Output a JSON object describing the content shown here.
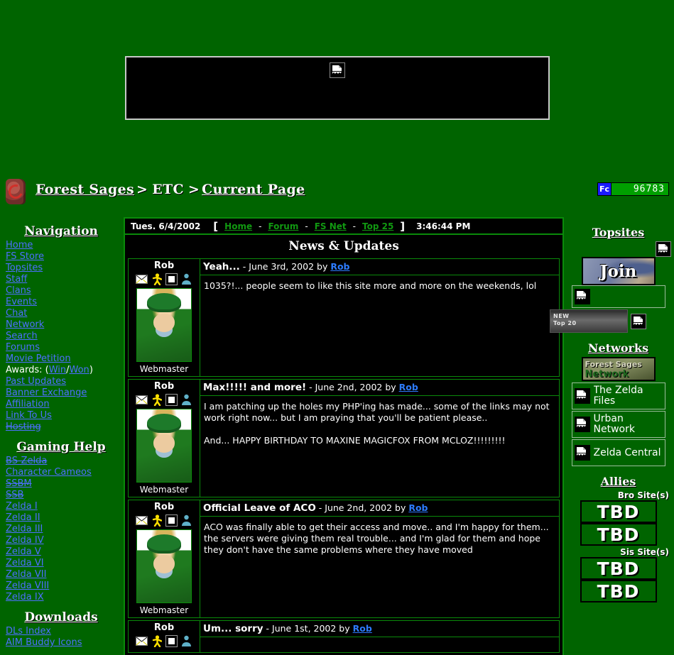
{
  "site": {
    "background_color": "#006400",
    "panel_color": "#000000",
    "border_color": "#0a8a0a",
    "link_color": "#4d6fff"
  },
  "top_banner": {
    "alt": "broken-image",
    "icon": "broken-image-icon"
  },
  "header": {
    "crest_icon": "site-crest-icon",
    "breadcrumb": {
      "home_label": "Forest Sages",
      "sep1": ">",
      "section_label": "ETC",
      "sep2": ">",
      "current_label": "Current Page"
    },
    "counter": {
      "badge": "Fc",
      "value": "96783"
    }
  },
  "sidebar": {
    "navigation_title": "Navigation",
    "navigation_items": [
      {
        "label": "Home",
        "strike": false
      },
      {
        "label": "FS Store",
        "strike": false
      },
      {
        "label": "Topsites",
        "strike": false
      },
      {
        "label": "Staff",
        "strike": false
      },
      {
        "label": "Clans",
        "strike": false
      },
      {
        "label": "Events",
        "strike": false
      },
      {
        "label": "Chat",
        "strike": false
      },
      {
        "label": "Network",
        "strike": false
      },
      {
        "label": "Search",
        "strike": false
      },
      {
        "label": "Forums",
        "strike": false
      },
      {
        "label": "Movie Petition",
        "strike": false
      }
    ],
    "awards": {
      "prefix": "Awards: (",
      "win": "Win",
      "slash": "/",
      "won": "Won",
      "suffix": ")"
    },
    "navigation_items_2": [
      {
        "label": "Past Updates",
        "strike": false
      },
      {
        "label": "Banner Exchange",
        "strike": false
      },
      {
        "label": "Affiliation",
        "strike": false
      },
      {
        "label": "Link To Us",
        "strike": false
      },
      {
        "label": "Hosting",
        "strike": true
      }
    ],
    "gaming_help_title": "Gaming Help",
    "gaming_help_items": [
      {
        "label": "BS-Zelda",
        "strike": true
      },
      {
        "label": "Character Cameos",
        "strike": false
      },
      {
        "label": "SSBM",
        "strike": true
      },
      {
        "label": "SSB",
        "strike": true
      },
      {
        "label": "Zelda I",
        "strike": false
      },
      {
        "label": "Zelda II",
        "strike": false
      },
      {
        "label": "Zelda III",
        "strike": false
      },
      {
        "label": "Zelda IV",
        "strike": false
      },
      {
        "label": "Zelda V",
        "strike": false
      },
      {
        "label": "Zelda VI",
        "strike": false
      },
      {
        "label": "Zelda VII",
        "strike": false
      },
      {
        "label": "Zelda VIII",
        "strike": false
      },
      {
        "label": "Zelda IX",
        "strike": false
      }
    ],
    "downloads_title": "Downloads",
    "downloads_items": [
      {
        "label": "DLs Index",
        "strike": false
      },
      {
        "label": "AIM Buddy Icons",
        "strike": false
      }
    ]
  },
  "navbar": {
    "date": "Tues. 6/4/2002",
    "open_bracket": "[",
    "links": [
      {
        "label": "Home"
      },
      {
        "label": "Forum"
      },
      {
        "label": "FS Net"
      },
      {
        "label": "Top 25"
      }
    ],
    "dash": "-",
    "close_bracket": "]",
    "time": "3:46:44 PM"
  },
  "news": {
    "heading": "News & Updates",
    "posts": [
      {
        "author": "Rob",
        "role": "Webmaster",
        "icons": [
          "email-icon",
          "aim-icon",
          "icq-icon",
          "profile-icon"
        ],
        "title": "Yeah...",
        "dash": "-",
        "date": "June 3rd, 2002",
        "by": "by",
        "author_link": "Rob",
        "text": "1035?!... people seem to like this site more and more on the weekends, lol"
      },
      {
        "author": "Rob",
        "role": "Webmaster",
        "icons": [
          "email-icon",
          "aim-icon",
          "icq-icon",
          "profile-icon"
        ],
        "title": "Max!!!!! and more!",
        "dash": "-",
        "date": "June 2nd, 2002",
        "by": "by",
        "author_link": "Rob",
        "text": "I am patching up the holes my PHP'ing has made... some of the links may not work right now... but I am praying that you'll be patient please..\n\nAnd... HAPPY BIRTHDAY TO MAXINE MAGICFOX FROM MCLOZ!!!!!!!!!"
      },
      {
        "author": "Rob",
        "role": "Webmaster",
        "icons": [
          "email-icon",
          "aim-icon",
          "icq-icon",
          "profile-icon"
        ],
        "title": "Official Leave of ACO",
        "dash": "-",
        "date": "June 2nd, 2002",
        "by": "by",
        "author_link": "Rob",
        "text": "ACO was finally able to get their access and move.. and I'm happy for them... the servers were giving them real trouble... and I'm glad for them and hope they don't have the same problems where they have moved"
      },
      {
        "author": "Rob",
        "role": "Webmaster",
        "icons": [
          "email-icon",
          "aim-icon",
          "icq-icon",
          "profile-icon"
        ],
        "title": "Um... sorry",
        "dash": "-",
        "date": "June 1st, 2002",
        "by": "by",
        "author_link": "Rob",
        "text": ""
      }
    ]
  },
  "right": {
    "topsites_title": "Topsites",
    "topsites_join_label": "Join",
    "topsites_top20": {
      "line1": "NEW",
      "line2": "Top 20"
    },
    "networks_title": "Networks",
    "networks_banner": {
      "line1": "Forest Sages",
      "line2": "Network"
    },
    "networks_items": [
      {
        "label": "The Zelda Files"
      },
      {
        "label": "Urban Network"
      },
      {
        "label": "Zelda Central"
      }
    ],
    "allies_title": "Allies",
    "bro_label": "Bro Site(s)",
    "bro_sites": [
      {
        "label": "TBD"
      },
      {
        "label": "TBD"
      }
    ],
    "sis_label": "Sis Site(s)",
    "sis_sites": [
      {
        "label": "TBD"
      },
      {
        "label": "TBD"
      }
    ]
  }
}
